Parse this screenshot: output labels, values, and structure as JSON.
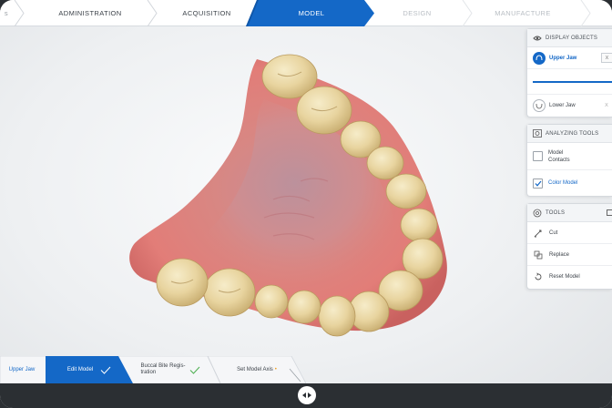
{
  "workflow": {
    "steps": [
      {
        "label": "ADMINISTRATION",
        "state": "done"
      },
      {
        "label": "ACQUISITION",
        "state": "done"
      },
      {
        "label": "MODEL",
        "state": "active"
      },
      {
        "label": "DESIGN",
        "state": "disabled"
      },
      {
        "label": "MANUFACTURE",
        "state": "disabled"
      }
    ],
    "left_fragment": "s"
  },
  "display_objects": {
    "title": "DISPLAY OBJECTS",
    "upper_jaw": {
      "label": "Upper Jaw",
      "tag": "X",
      "selected": true
    },
    "lower_jaw": {
      "label": "Lower Jaw",
      "tag": "X",
      "selected": false
    }
  },
  "analyzing_tools": {
    "title": "ANALYZING TOOLS",
    "items": [
      {
        "label_line1": "Model",
        "label_line2": "Contacts",
        "checked": false
      },
      {
        "label": "Color Model",
        "checked": true
      }
    ]
  },
  "tools": {
    "title": "TOOLS",
    "items": [
      {
        "label": "Cut",
        "icon": "cut-icon"
      },
      {
        "label": "Replace",
        "icon": "replace-icon"
      },
      {
        "label": "Reset Model",
        "icon": "reset-icon"
      }
    ]
  },
  "bottom_tabs": {
    "upper_jaw": "Upper Jaw",
    "edit_model": "Edit Model",
    "buccal_line1": "Buccal Bite Regis-",
    "buccal_line2": "tration",
    "set_axis": "Set Model Axis",
    "set_axis_marker": "•"
  },
  "colors": {
    "accent": "#1468c7",
    "bar_dark": "#2b2f33",
    "gum": "#d87b78",
    "tooth": "#ead9a8"
  }
}
